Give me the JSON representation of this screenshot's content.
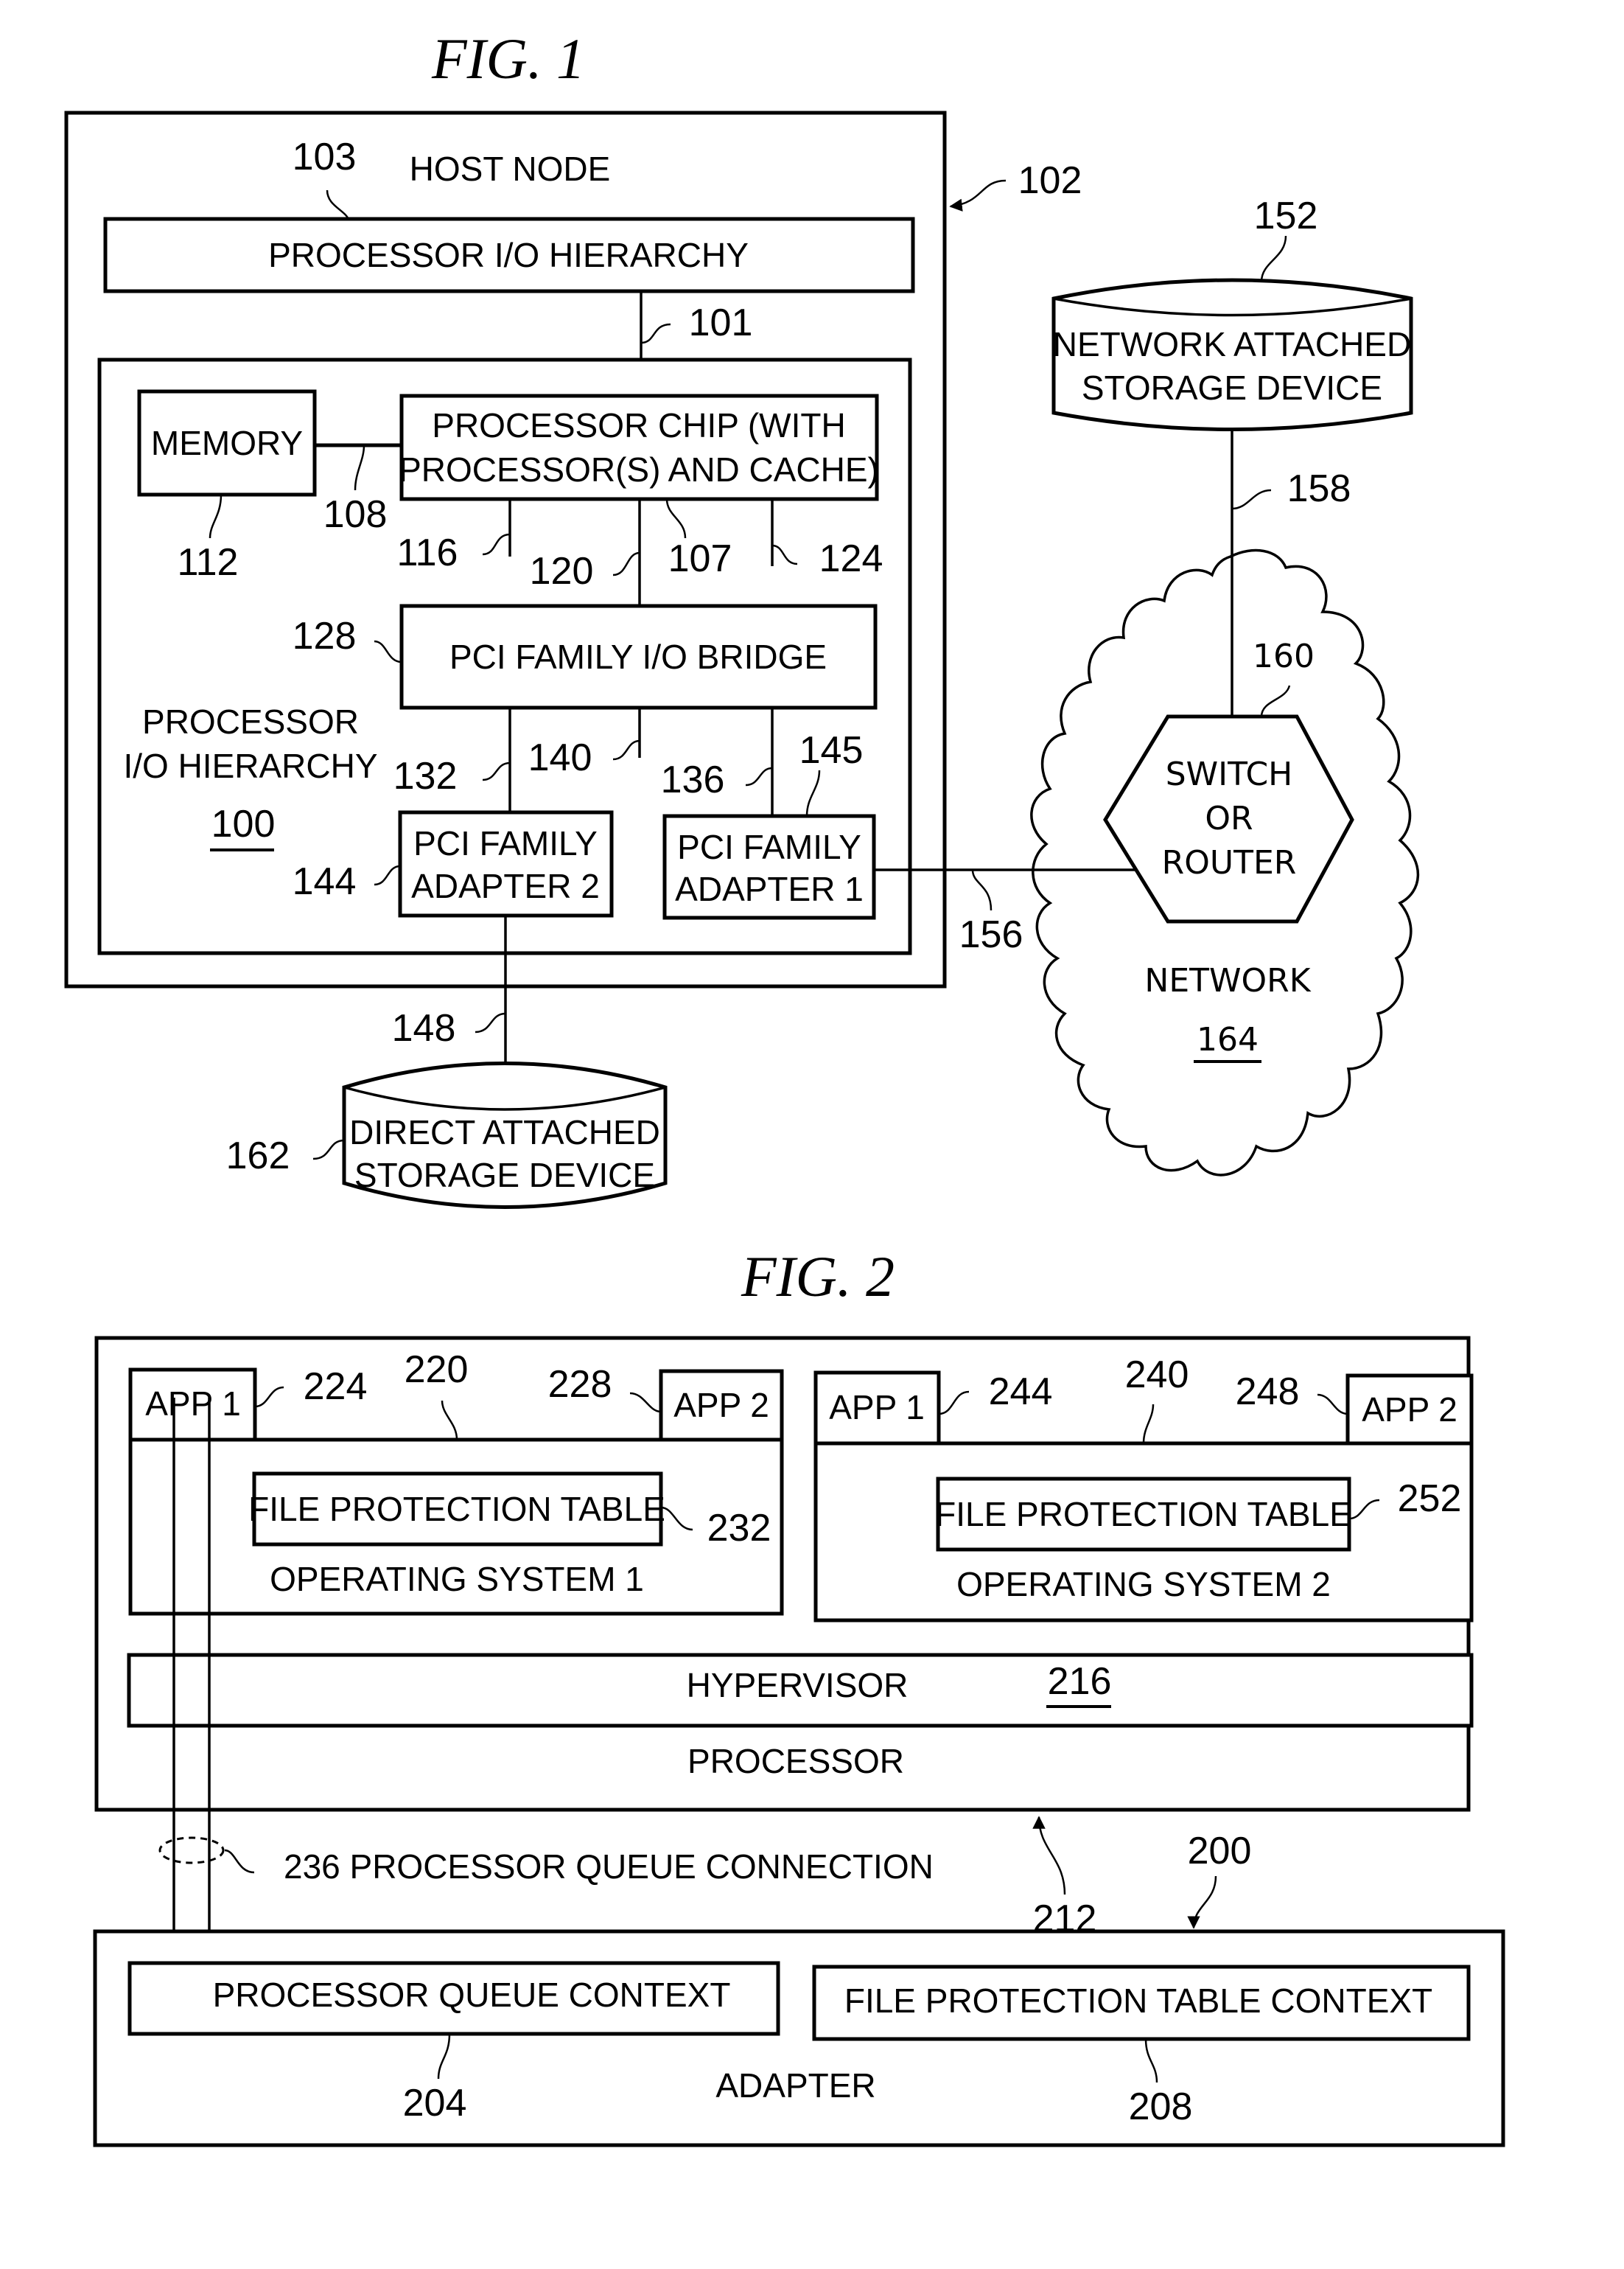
{
  "fig1": {
    "title": "FIG. 1",
    "host_node": {
      "label": "HOST NODE",
      "ref": "102",
      "inner_ref": "103"
    },
    "processor_io_hierarchy_bar": {
      "label": "PROCESSOR I/O HIERARCHY",
      "link_ref": "101"
    },
    "processor_io_hierarchy_group": {
      "label_line1": "PROCESSOR",
      "label_line2": "I/O HIERARCHY",
      "ref": "100"
    },
    "memory": {
      "label": "MEMORY",
      "ref": "112",
      "bus_ref": "108"
    },
    "processor_chip": {
      "label_line1": "PROCESSOR CHIP (WITH",
      "label_line2": "PROCESSOR(S) AND CACHE)",
      "ref": "107"
    },
    "chip_bus_refs": [
      "116",
      "120",
      "124"
    ],
    "pci_bridge": {
      "label": "PCI FAMILY I/O BRIDGE",
      "ref": "128"
    },
    "bridge_bus_refs": [
      "132",
      "140",
      "136"
    ],
    "adapter2": {
      "label_line1": "PCI FAMILY",
      "label_line2": "ADAPTER 2",
      "ref": "144"
    },
    "adapter1": {
      "label_line1": "PCI FAMILY",
      "label_line2": "ADAPTER 1",
      "ref": "145"
    },
    "nas": {
      "label_line1": "NETWORK ATTACHED",
      "label_line2": "STORAGE DEVICE",
      "ref": "152",
      "link_ref": "158"
    },
    "switch": {
      "label_line1": "SWITCH",
      "label_line2": "OR",
      "label_line3": "ROUTER",
      "ref": "160"
    },
    "network": {
      "label": "NETWORK",
      "ref": "164",
      "link_ref": "156"
    },
    "das": {
      "label_line1": "DIRECT ATTACHED",
      "label_line2": "STORAGE DEVICE",
      "ref": "162",
      "link_ref": "148"
    }
  },
  "fig2": {
    "title": "FIG. 2",
    "system_ref": "200",
    "processor": {
      "label": "PROCESSOR",
      "ref": "212"
    },
    "os1": {
      "label": "OPERATING SYSTEM 1",
      "ref": "220",
      "app1": "APP 1",
      "app1_ref": "224",
      "app2": "APP 2",
      "app2_ref": "228",
      "fpt": "FILE PROTECTION TABLE",
      "fpt_ref": "232"
    },
    "os2": {
      "label": "OPERATING SYSTEM 2",
      "ref": "240",
      "app1": "APP 1",
      "app1_ref": "244",
      "app2": "APP 2",
      "app2_ref": "248",
      "fpt": "FILE PROTECTION TABLE",
      "fpt_ref": "252"
    },
    "hypervisor": {
      "label": "HYPERVISOR",
      "ref": "216"
    },
    "queue_connection": {
      "label": "236 PROCESSOR QUEUE CONNECTION"
    },
    "adapter": {
      "label": "ADAPTER"
    },
    "pqc": {
      "label": "PROCESSOR QUEUE CONTEXT",
      "ref": "204"
    },
    "fptc": {
      "label": "FILE PROTECTION TABLE CONTEXT",
      "ref": "208"
    }
  }
}
